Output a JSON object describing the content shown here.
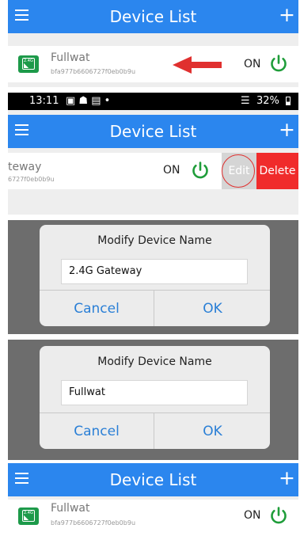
{
  "colors": {
    "appbar": "#2b86ee",
    "power_on": "#1f9d3a",
    "edit_bg": "#d5d5d5",
    "delete_bg": "#f02b2b",
    "arrow": "#e0302f",
    "dialog_button": "#2a7fd6"
  },
  "panel1": {
    "appbar": {
      "title": "Device List",
      "menu_icon": "hamburger-icon",
      "add_icon": "+"
    },
    "device": {
      "name": "Fullwat",
      "id": "bfa977b6606727f0eb0b9u",
      "state": "ON",
      "icon": "gateway-2.4g-icon",
      "icon_tag": "2.4G"
    },
    "annotation": "arrow-pointing-left"
  },
  "panel2": {
    "status_bar": {
      "time": "13:11",
      "notification_icons": "▣ ☗ ▤ •",
      "battery": "32%"
    },
    "appbar": {
      "title": "Device List",
      "menu_icon": "hamburger-icon",
      "add_icon": "+"
    },
    "device": {
      "name": "teway",
      "id": "6727f0eb0b9u",
      "state": "ON",
      "edit_label": "Edit",
      "delete_label": "Delete"
    }
  },
  "panel3": {
    "dialog": {
      "title": "Modify Device Name",
      "value": "2.4G Gateway",
      "cancel_label": "Cancel",
      "ok_label": "OK"
    }
  },
  "panel4": {
    "dialog": {
      "title": "Modify Device Name",
      "value": "Fullwat",
      "cancel_label": "Cancel",
      "ok_label": "OK"
    }
  },
  "panel5": {
    "appbar": {
      "title": "Device List",
      "menu_icon": "hamburger-icon",
      "add_icon": "+"
    },
    "device": {
      "name": "Fullwat",
      "id": "bfa977b6606727f0eb0b9u",
      "state": "ON",
      "icon": "gateway-2.4g-icon",
      "icon_tag": "2.4G"
    }
  }
}
